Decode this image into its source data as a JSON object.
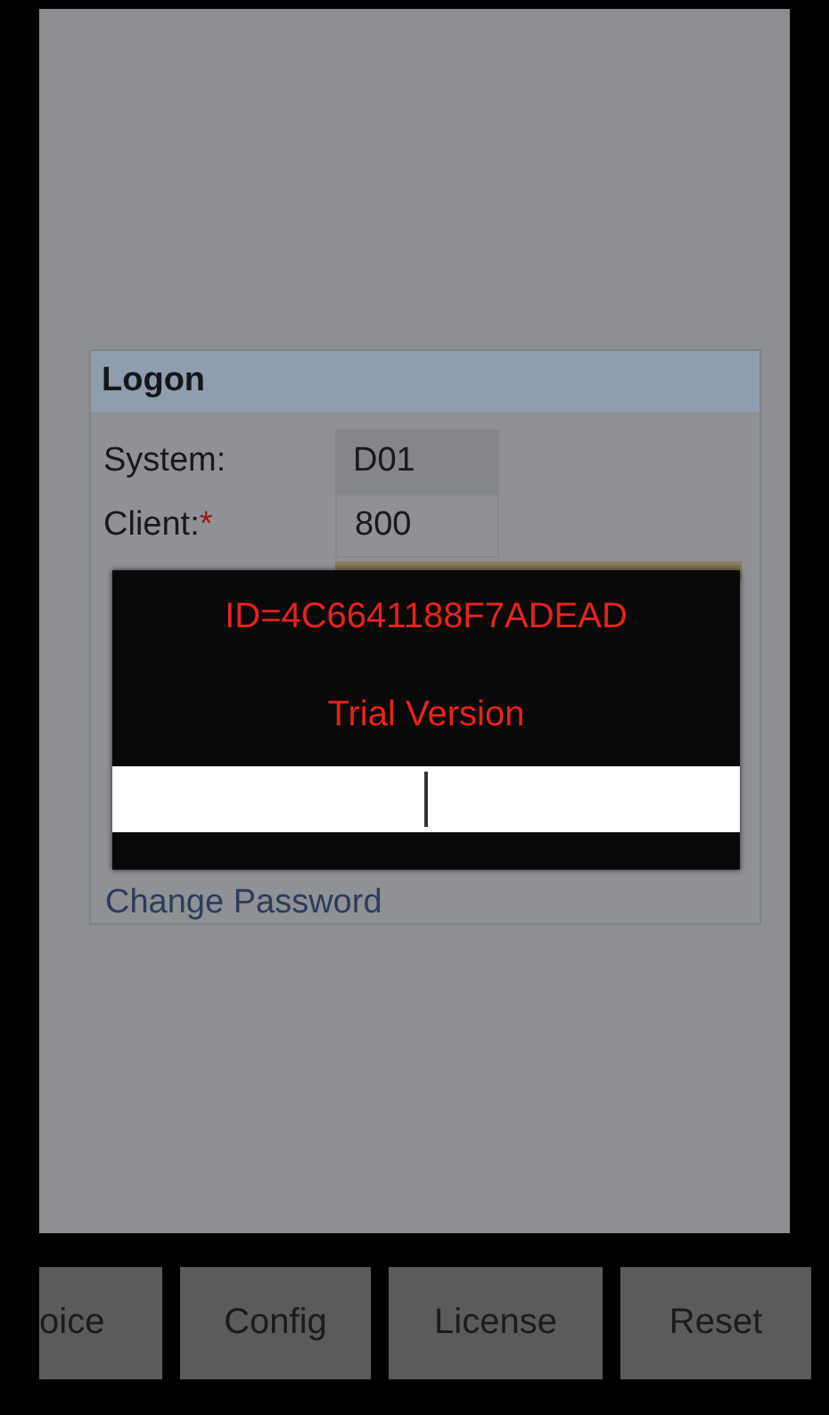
{
  "logon": {
    "title": "Logon",
    "fields": [
      {
        "label": "System:",
        "kind": "readonly",
        "value": "D01"
      },
      {
        "label": "Client:",
        "asterisk": "*",
        "kind": "input",
        "value": "800"
      }
    ],
    "link": "Change Password"
  },
  "dialog": {
    "id_text": "ID=4C6641188F7ADEAD",
    "message": "Trial Version"
  },
  "buttons": [
    "oice",
    "Config",
    "License",
    "Reset"
  ]
}
